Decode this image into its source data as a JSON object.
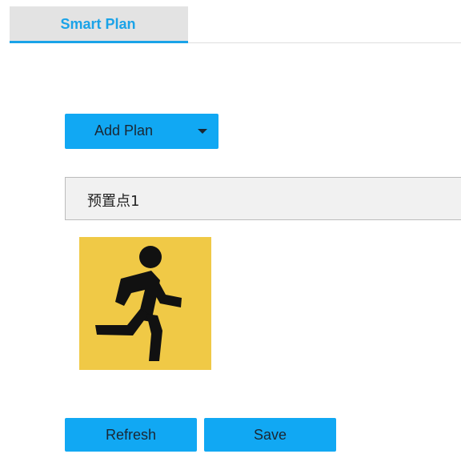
{
  "tabs": [
    {
      "label": "Smart Plan",
      "active": true
    }
  ],
  "toolbar": {
    "add_plan_label": "Add Plan"
  },
  "preset": {
    "label": "预置点1"
  },
  "plan_icon": {
    "icon": "running-person-icon",
    "background": "#f0c946"
  },
  "actions": {
    "refresh_label": "Refresh",
    "save_label": "Save"
  },
  "colors": {
    "accent": "#11a8f3",
    "tab_text": "#1aa3e8"
  }
}
